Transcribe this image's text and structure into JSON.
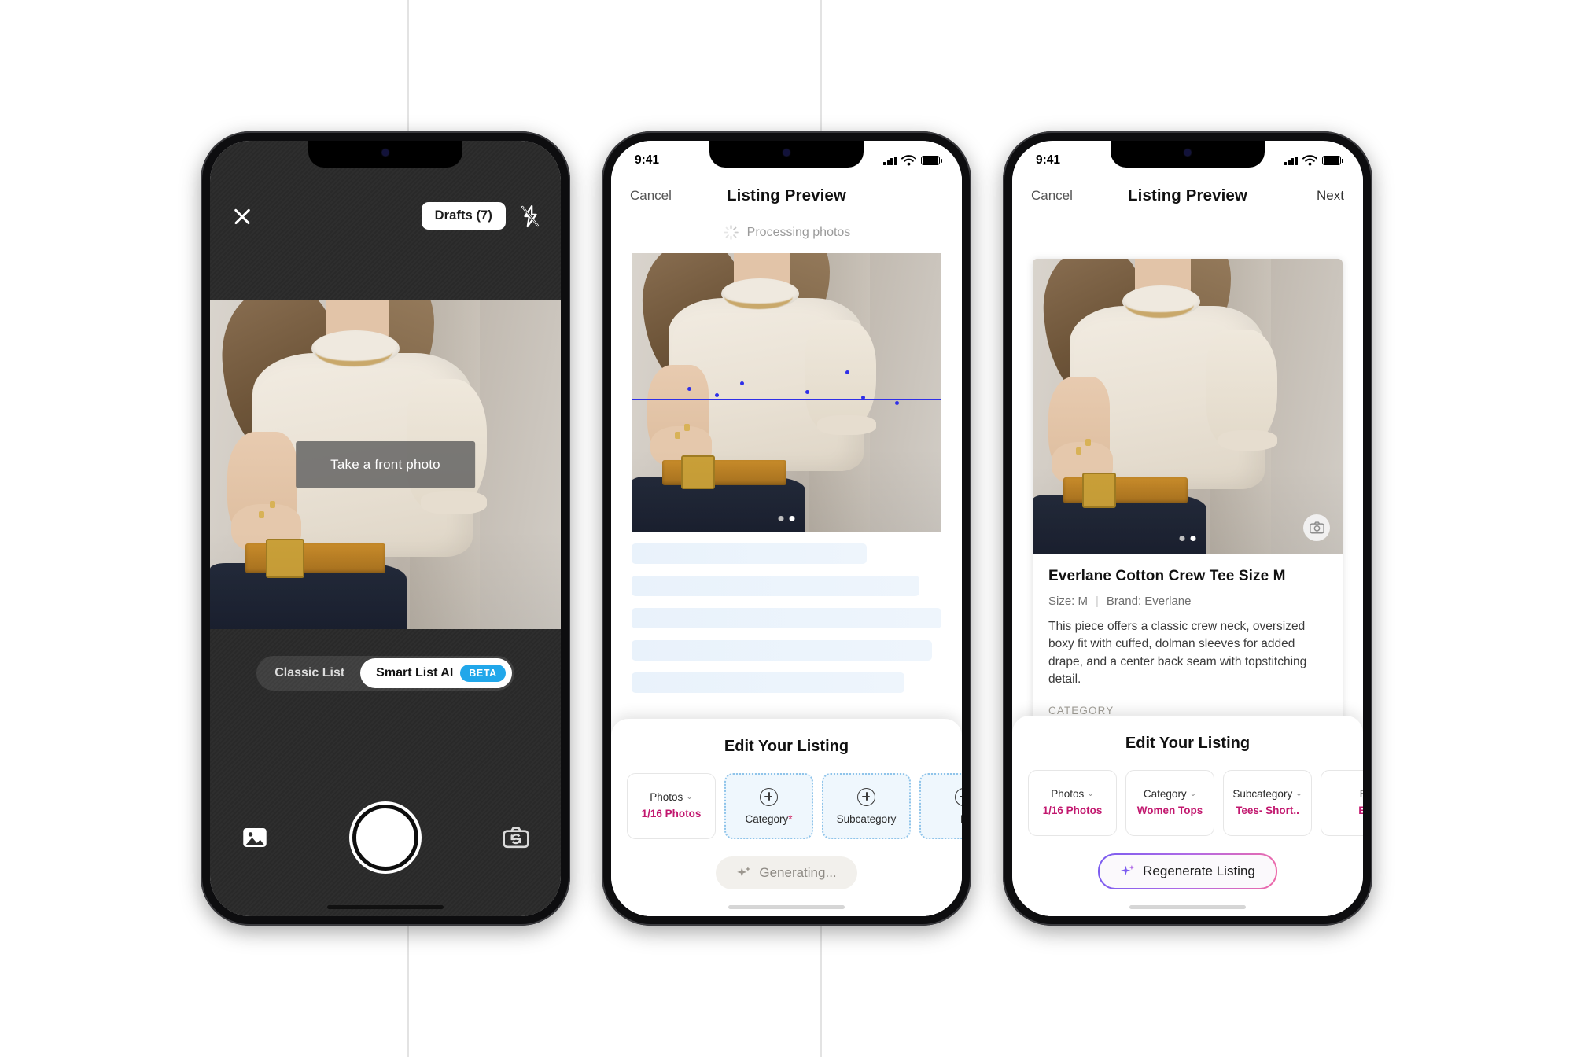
{
  "screens": [
    {
      "id": "camera",
      "topbar": {
        "close_icon": "close-icon",
        "drafts_label": "Drafts (7)",
        "flash_icon": "flash-off-icon"
      },
      "overlay_hint": "Take a front photo",
      "modes": [
        {
          "label": "Classic List",
          "active": false,
          "badge": null
        },
        {
          "label": "Smart List AI",
          "active": true,
          "badge": "BETA"
        }
      ],
      "bottom": {
        "gallery_icon": "gallery-icon",
        "shutter": "shutter-button",
        "flip_icon": "camera-flip-icon"
      }
    },
    {
      "id": "processing",
      "statusbar": {
        "time": "9:41",
        "cellular": "signal-icon",
        "wifi": "wifi-icon",
        "battery": "battery-icon"
      },
      "nav": {
        "left": "Cancel",
        "title": "Listing Preview",
        "right": ""
      },
      "processing_label": "Processing photos",
      "sheet": {
        "title": "Edit Your Listing",
        "chips": [
          {
            "label": "Photos",
            "caret": true,
            "value": "1/16 Photos",
            "style": "solid",
            "icon": null,
            "required": false
          },
          {
            "label": "Category",
            "caret": false,
            "value": null,
            "style": "dashed",
            "icon": "plus-circle-icon",
            "required": true
          },
          {
            "label": "Subcategory",
            "caret": false,
            "value": null,
            "style": "dashed",
            "icon": "plus-circle-icon",
            "required": false
          },
          {
            "label": "B",
            "caret": false,
            "value": null,
            "style": "dashed",
            "icon": "plus-circle-icon",
            "required": false
          }
        ],
        "cta": {
          "label": "Generating...",
          "icon": "sparkle-icon",
          "state": "disabled"
        }
      }
    },
    {
      "id": "preview",
      "statusbar": {
        "time": "9:41",
        "cellular": "signal-icon",
        "wifi": "wifi-icon",
        "battery": "battery-icon"
      },
      "nav": {
        "left": "Cancel",
        "title": "Listing Preview",
        "right": "Next"
      },
      "listing": {
        "title": "Everlane Cotton Crew Tee Size M",
        "size": "Size: M",
        "brand": "Brand: Everlane",
        "description": "This piece offers a classic crew neck, oversized boxy fit with cuffed, dolman sleeves for added drape, and a center back seam with topstitching detail.",
        "section_label": "CATEGORY",
        "camera_fab_icon": "camera-icon"
      },
      "sheet": {
        "title": "Edit Your Listing",
        "chips": [
          {
            "label": "Photos",
            "caret": true,
            "value": "1/16 Photos",
            "style": "solid"
          },
          {
            "label": "Category",
            "caret": true,
            "value": "Women\nTops",
            "style": "solid"
          },
          {
            "label": "Subcategory",
            "caret": true,
            "value": "Tees- Short..",
            "style": "solid"
          },
          {
            "label": "Br",
            "caret": false,
            "value": "Ev",
            "style": "solid"
          }
        ],
        "cta": {
          "label": "Regenerate Listing",
          "icon": "sparkle-icon",
          "state": "enabled"
        }
      }
    }
  ],
  "colors": {
    "beta_badge": "#21a7ea",
    "chip_value": "#c2186f",
    "scan_line": "#2f2fe8",
    "dashed_border": "#8fc4ea",
    "dashed_fill": "#eff7fd"
  }
}
